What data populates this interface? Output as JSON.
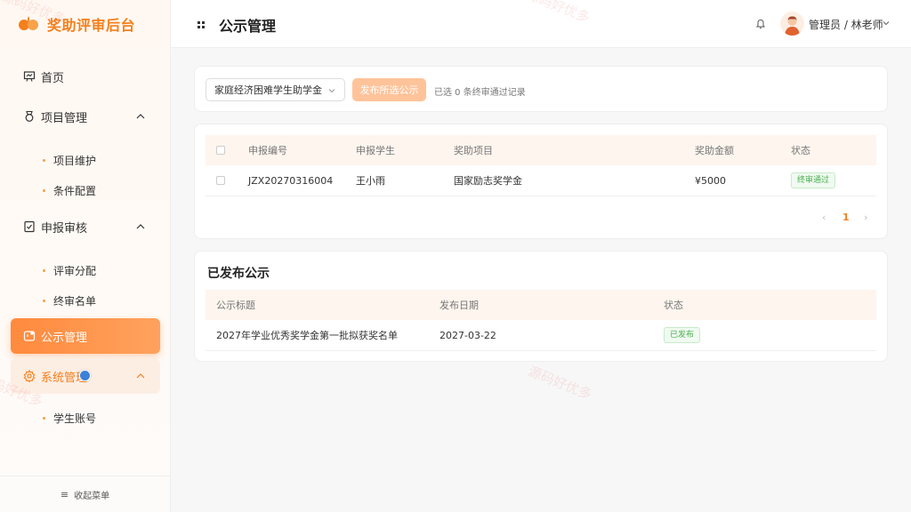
{
  "brand": {
    "title": "奖助评审后台",
    "accent": "#f57f1c"
  },
  "sidebar": {
    "items": [
      {
        "label": "首页",
        "icon": "presentation-icon"
      },
      {
        "label": "项目管理",
        "icon": "medal-icon",
        "expanded": true
      },
      {
        "label": "项目维护"
      },
      {
        "label": "条件配置"
      },
      {
        "label": "申报审核",
        "icon": "document-check-icon",
        "expanded": true
      },
      {
        "label": "评审分配"
      },
      {
        "label": "终审名单"
      },
      {
        "label": "公示管理",
        "icon": "notice-icon",
        "active": true
      },
      {
        "label": "系统管理",
        "icon": "gear-icon",
        "expanded": true
      },
      {
        "label": "学生账号"
      }
    ],
    "collapse_label": "收起菜单"
  },
  "header": {
    "title": "公示管理",
    "user": "管理员 / 林老师"
  },
  "toolbar": {
    "select_value": "家庭经济困难学生助学金",
    "publish_label": "发布所选公示",
    "selected_info": "已选 0 条终审通过记录"
  },
  "pending_table": {
    "columns": [
      "申报编号",
      "申报学生",
      "奖助项目",
      "奖助金额",
      "状态"
    ],
    "rows": [
      {
        "id": "JZX20270316004",
        "student": "王小雨",
        "project": "国家励志奖学金",
        "amount": "¥5000",
        "status": "终审通过"
      }
    ],
    "pager": {
      "prev": "‹",
      "page": "1",
      "next": "›"
    }
  },
  "published": {
    "title": "已发布公示",
    "columns": [
      "公示标题",
      "发布日期",
      "状态"
    ],
    "rows": [
      {
        "title": "2027年学业优秀奖学金第一批拟获奖名单",
        "date": "2027-03-22",
        "status": "已发布"
      }
    ]
  },
  "watermark": "源码好优多"
}
